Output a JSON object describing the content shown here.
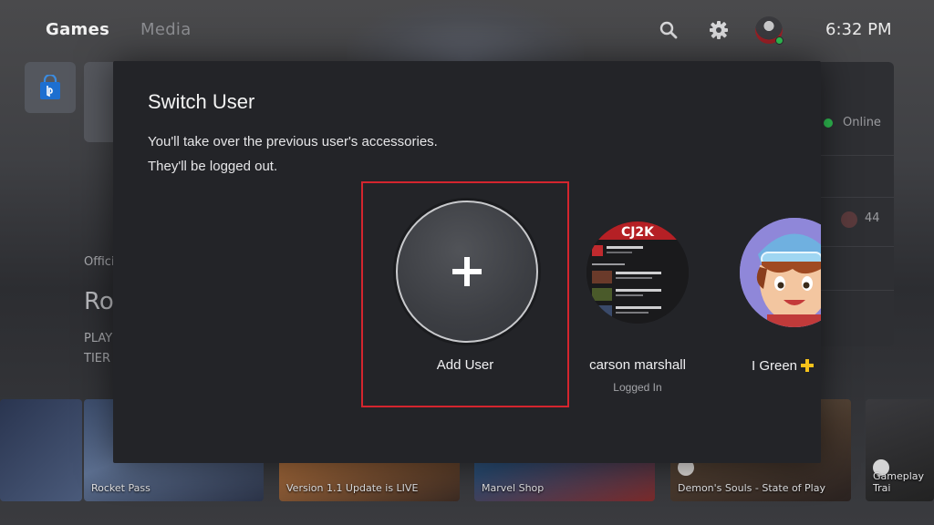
{
  "nav": {
    "tabs": [
      {
        "label": "Games",
        "active": true
      },
      {
        "label": "Media",
        "active": false
      }
    ],
    "search_icon": "search-icon",
    "settings_icon": "gear-icon",
    "clock": "6:32 PM"
  },
  "background": {
    "left_text_official": "Offici",
    "left_game_title": "Ro",
    "left_line1": "PLAY",
    "left_line2": "TIER",
    "right_panel": {
      "online_label": "Online",
      "trophy_count": "44"
    },
    "tiles": [
      {
        "label": "Rocket Pass"
      },
      {
        "label": "Version 1.1 Update is LIVE"
      },
      {
        "label": "Marvel Shop"
      },
      {
        "label": "Demon's Souls - State of Play"
      },
      {
        "label": "Gameplay Trai"
      }
    ]
  },
  "modal": {
    "title": "Switch User",
    "description_line1": "You'll take over the previous user's accessories.",
    "description_line2": "They'll be logged out.",
    "users": [
      {
        "name": "Add User",
        "status": ""
      },
      {
        "name": "carson marshall",
        "status": "Logged In"
      },
      {
        "name": "I Green",
        "status": ""
      }
    ],
    "cj_banner": "CJ2K"
  },
  "colors": {
    "focus_border": "#d4252e",
    "online": "#2fbf52",
    "modal_bg": "#232428"
  }
}
